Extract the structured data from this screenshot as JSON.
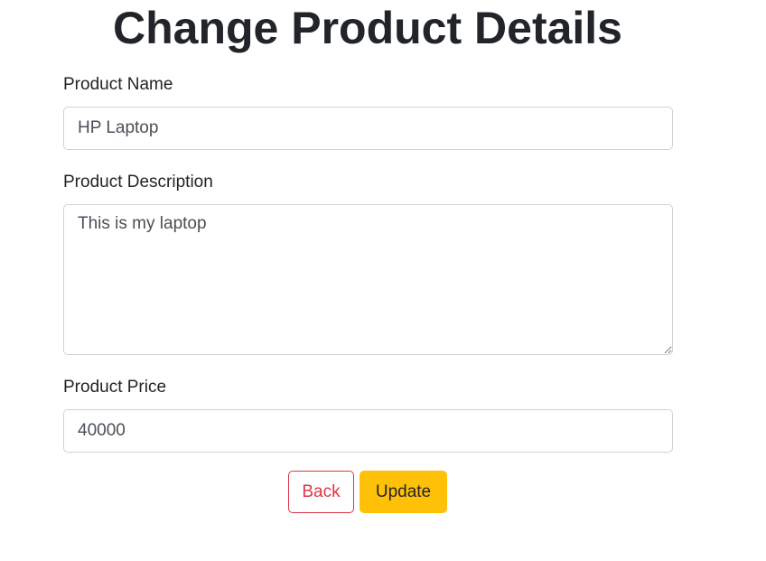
{
  "page": {
    "title": "Change Product Details"
  },
  "form": {
    "name": {
      "label": "Product Name",
      "value": "HP Laptop"
    },
    "description": {
      "label": "Product Description",
      "value": "This is my laptop"
    },
    "price": {
      "label": "Product Price",
      "value": "40000"
    }
  },
  "actions": {
    "back_label": "Back",
    "update_label": "Update"
  },
  "colors": {
    "back_border": "#dc3545",
    "update_bg": "#ffc107",
    "input_border": "#ced4da"
  }
}
